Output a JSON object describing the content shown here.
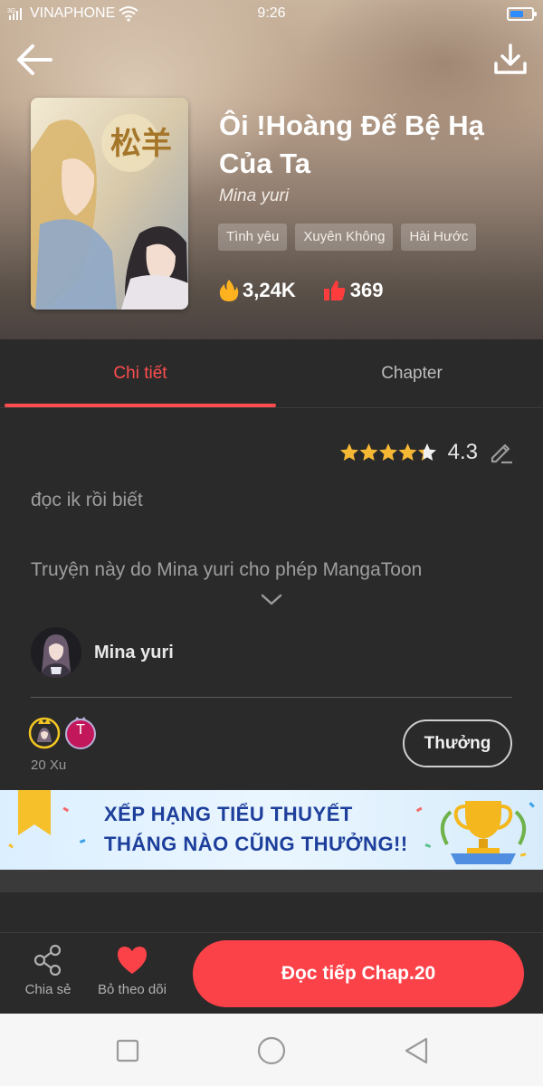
{
  "status_bar": {
    "carrier": "VINAPHONE",
    "time": "9:26"
  },
  "book": {
    "title": "Ôi !Hoàng Đế Bệ Hạ Của Ta",
    "author": "Mina yuri",
    "tags": [
      "Tình yêu",
      "Xuyên Không",
      "Hài Hước"
    ],
    "views": "3,24K",
    "likes": "369"
  },
  "tabs": {
    "detail": "Chi tiết",
    "chapter": "Chapter"
  },
  "rating": {
    "value": "4.3",
    "stars": 4.3
  },
  "description": {
    "line1": "đọc ik rồi biết",
    "line2": "Truyện này do Mina yuri cho phép MangaToon"
  },
  "author_card": {
    "name": "Mina yuri"
  },
  "donors": {
    "second_initial": "T",
    "amount": "20 Xu",
    "reward_label": "Thưởng"
  },
  "banner": {
    "line1": "XẾP HẠNG TIỂU THUYẾT",
    "line2": "THÁNG NÀO CŨNG THƯỞNG!!"
  },
  "bottom_bar": {
    "share": "Chia sẻ",
    "unfollow": "Bỏ theo dõi",
    "read": "Đọc tiếp Chap.20"
  },
  "colors": {
    "accent": "#fc4249",
    "tab_active": "#ff4d4f",
    "star": "#f5b835"
  }
}
